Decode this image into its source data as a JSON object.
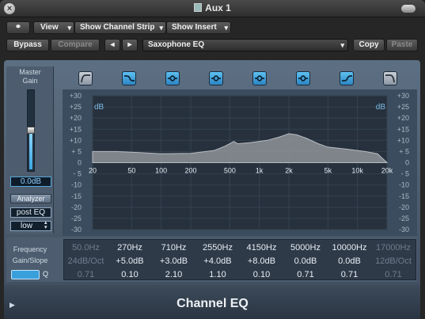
{
  "window": {
    "title": "Aux 1"
  },
  "toolbar": {
    "view": "View",
    "show_channel_strip": "Show Channel Strip",
    "show_insert": "Show Insert",
    "bypass": "Bypass",
    "compare": "Compare",
    "prev": "◂",
    "next": "▸",
    "preset": "Saxophone EQ",
    "copy": "Copy",
    "paste": "Paste"
  },
  "left_panel": {
    "master_gain_line1": "Master",
    "master_gain_line2": "Gain",
    "gain_value": "0.0dB",
    "gain_level": 0.5,
    "analyzer": "Analyzer",
    "mode": "post EQ",
    "resolution": "low"
  },
  "bands": [
    {
      "icon": "high-pass-icon",
      "on": false
    },
    {
      "icon": "low-shelf-icon",
      "on": true
    },
    {
      "icon": "peak-icon",
      "on": true
    },
    {
      "icon": "peak-icon",
      "on": true
    },
    {
      "icon": "peak-icon",
      "on": true
    },
    {
      "icon": "peak-icon",
      "on": true
    },
    {
      "icon": "high-shelf-icon",
      "on": true
    },
    {
      "icon": "low-pass-icon",
      "on": false
    }
  ],
  "graph": {
    "unit_left": "dB",
    "unit_right": "dB",
    "y_ticks_left": [
      "+30",
      "+25",
      "+20",
      "+15",
      "+10",
      "+ 5",
      "0",
      "- 5",
      "-10",
      "-15",
      "-20",
      "-25",
      "-30"
    ],
    "y_ticks_right": [
      "+30",
      "+25",
      "+20",
      "+15",
      "+10",
      "+ 5",
      "0",
      "- 5",
      "-10",
      "-15",
      "-20",
      "-25",
      "-30"
    ],
    "x_ticks": [
      "20",
      "50",
      "100",
      "200",
      "500",
      "1k",
      "2k",
      "5k",
      "10k",
      "20k"
    ],
    "x_tick_values": [
      20,
      50,
      100,
      200,
      500,
      1000,
      2000,
      5000,
      10000,
      20000
    ],
    "curve_color": "#8a8e94",
    "curve": [
      [
        20,
        5
      ],
      [
        35,
        5
      ],
      [
        60,
        4.5
      ],
      [
        100,
        4
      ],
      [
        200,
        4.2
      ],
      [
        350,
        5.5
      ],
      [
        450,
        7.5
      ],
      [
        550,
        9.5
      ],
      [
        600,
        8.5
      ],
      [
        800,
        9
      ],
      [
        1200,
        10
      ],
      [
        1600,
        11.5
      ],
      [
        2000,
        13
      ],
      [
        2400,
        12.5
      ],
      [
        3000,
        11
      ],
      [
        4000,
        8.5
      ],
      [
        5000,
        7
      ],
      [
        8000,
        6
      ],
      [
        12000,
        5
      ],
      [
        16000,
        4
      ],
      [
        20000,
        0
      ]
    ]
  },
  "params": {
    "label_frequency": "Frequency",
    "label_gain_slope": "Gain/Slope",
    "label_q": "Q",
    "freq": [
      "50.0Hz",
      "270Hz",
      "710Hz",
      "2550Hz",
      "4150Hz",
      "5000Hz",
      "10000Hz",
      "17000Hz"
    ],
    "gain": [
      "24dB/Oct",
      "+5.0dB",
      "+3.0dB",
      "+4.0dB",
      "+8.0dB",
      "0.0dB",
      "0.0dB",
      "12dB/Oct"
    ],
    "q": [
      "0.71",
      "0.10",
      "2.10",
      "1.10",
      "0.10",
      "0.71",
      "0.71",
      "0.71"
    ],
    "active": [
      false,
      true,
      true,
      true,
      true,
      true,
      true,
      false
    ]
  },
  "footer": {
    "plugin_name": "Channel EQ"
  }
}
